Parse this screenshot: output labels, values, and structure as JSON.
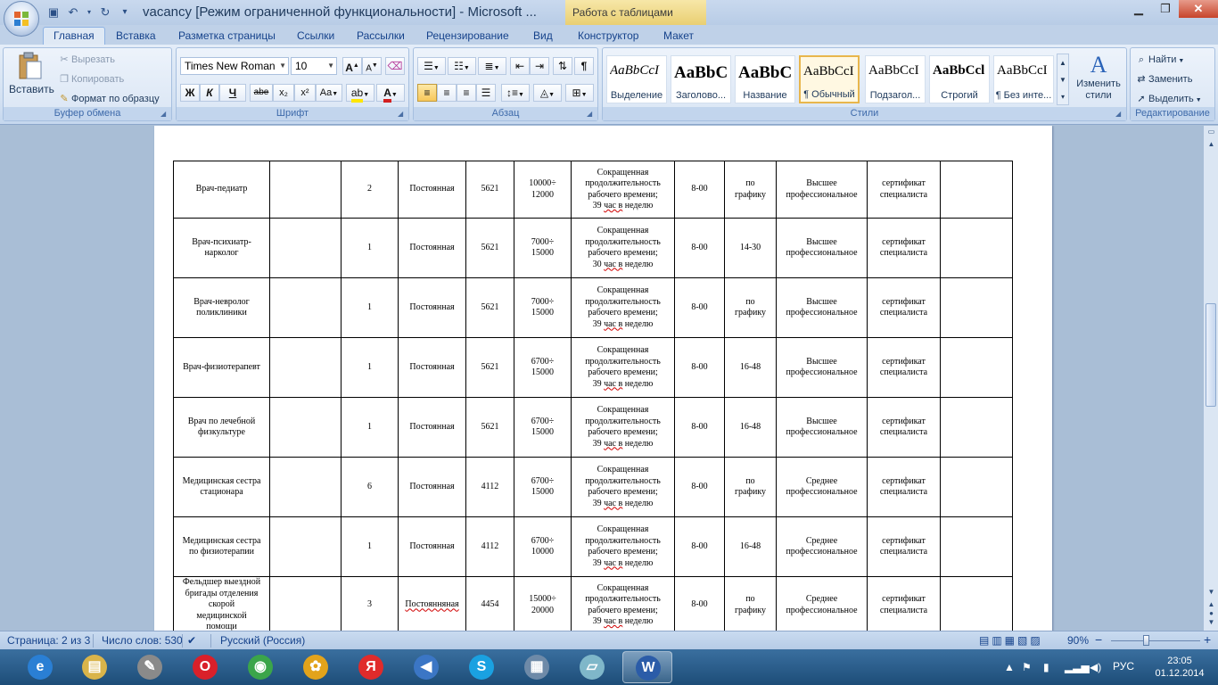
{
  "window": {
    "title": "vacancy [Режим ограниченной функциональности] - Microsoft ...",
    "context_tab_title": "Работа с таблицами"
  },
  "qat": {
    "save_icon": "save-icon",
    "undo_icon": "undo-icon",
    "redo_icon": "redo-icon"
  },
  "tabs": [
    "Главная",
    "Вставка",
    "Разметка страницы",
    "Ссылки",
    "Рассылки",
    "Рецензирование",
    "Вид",
    "Конструктор",
    "Макет"
  ],
  "clipboard": {
    "paste": "Вставить",
    "cut": "Вырезать",
    "copy": "Копировать",
    "format_painter": "Формат по образцу",
    "label": "Буфер обмена"
  },
  "font": {
    "name": "Times New Roman",
    "size": "10",
    "label": "Шрифт",
    "bold": "Ж",
    "italic": "К",
    "underline": "Ч",
    "strike": "abe",
    "sub": "x₂",
    "sup": "x²",
    "case": "Aa",
    "grow": "A",
    "shrink": "A"
  },
  "paragraph": {
    "label": "Абзац",
    "show_marks": "¶"
  },
  "styles": {
    "label": "Стили",
    "items": [
      {
        "sample": "AaBbCcI",
        "name": "Выделение"
      },
      {
        "sample": "AaBbC",
        "name": "Заголово..."
      },
      {
        "sample": "AaBbC",
        "name": "Название"
      },
      {
        "sample": "AaBbCcI",
        "name": "¶ Обычный"
      },
      {
        "sample": "AaBbCcI",
        "name": "Подзагол..."
      },
      {
        "sample": "AaBbCcl",
        "name": "Строгий"
      },
      {
        "sample": "AaBbCcI",
        "name": "¶ Без инте..."
      }
    ],
    "change_styles": "Изменить стили"
  },
  "editing": {
    "label": "Редактирование",
    "find": "Найти",
    "replace": "Заменить",
    "select": "Выделить"
  },
  "table_rows": [
    {
      "position": [
        "Врач-педиатр"
      ],
      "col2": "",
      "count": "2",
      "type": "Постоянная",
      "code": "5621",
      "salary": [
        "10000÷",
        "12000"
      ],
      "mode": [
        "Сокращенная",
        "продолжительность",
        "рабочего времени;",
        "39 час в неделю"
      ],
      "start": "8-00",
      "schedule": [
        "по",
        "графику"
      ],
      "education": [
        "Высшее",
        "профессиональное"
      ],
      "cert": [
        "сертификат",
        "специалиста"
      ],
      "last": ""
    },
    {
      "position": [
        "Врач-психиатр-",
        "нарколог"
      ],
      "col2": "",
      "count": "1",
      "type": "Постоянная",
      "code": "5621",
      "salary": [
        "7000÷",
        "15000"
      ],
      "mode": [
        "Сокращенная",
        "продолжительность",
        "рабочего времени;",
        "30 час в неделю"
      ],
      "start": "8-00",
      "schedule": [
        "14-30"
      ],
      "education": [
        "Высшее",
        "профессиональное"
      ],
      "cert": [
        "сертификат",
        "специалиста"
      ],
      "last": ""
    },
    {
      "position": [
        "Врач-невролог",
        "поликлиники"
      ],
      "col2": "",
      "count": "1",
      "type": "Постоянная",
      "code": "5621",
      "salary": [
        "7000÷",
        "15000"
      ],
      "mode": [
        "Сокращенная",
        "продолжительность",
        "рабочего времени;",
        "39 час в неделю"
      ],
      "start": "8-00",
      "schedule": [
        "по",
        "графику"
      ],
      "education": [
        "Высшее",
        "профессиональное"
      ],
      "cert": [
        "сертификат",
        "специалиста"
      ],
      "last": ""
    },
    {
      "position": [
        "Врач-физиотерапевт"
      ],
      "col2": "",
      "count": "1",
      "type": "Постоянная",
      "code": "5621",
      "salary": [
        "6700÷",
        "15000"
      ],
      "mode": [
        "Сокращенная",
        "продолжительность",
        "рабочего времени;",
        "39 час в неделю"
      ],
      "start": "8-00",
      "schedule": [
        "16-48"
      ],
      "education": [
        "Высшее",
        "профессиональное"
      ],
      "cert": [
        "сертификат",
        "специалиста"
      ],
      "last": ""
    },
    {
      "position": [
        "Врач по лечебной",
        "физкультуре"
      ],
      "col2": "",
      "count": "1",
      "type": "Постоянная",
      "code": "5621",
      "salary": [
        "6700÷",
        "15000"
      ],
      "mode": [
        "Сокращенная",
        "продолжительность",
        "рабочего времени;",
        "39 час в неделю"
      ],
      "start": "8-00",
      "schedule": [
        "16-48"
      ],
      "education": [
        "Высшее",
        "профессиональное"
      ],
      "cert": [
        "сертификат",
        "специалиста"
      ],
      "last": ""
    },
    {
      "position": [
        "Медицинская сестра",
        "стационара"
      ],
      "col2": "",
      "count": "6",
      "type": "Постоянная",
      "code": "4112",
      "salary": [
        "6700÷",
        "15000"
      ],
      "mode": [
        "Сокращенная",
        "продолжительность",
        "рабочего времени;",
        "39 час в неделю"
      ],
      "start": "8-00",
      "schedule": [
        "по",
        "графику"
      ],
      "education": [
        "Среднее",
        "профессиональное"
      ],
      "cert": [
        "сертификат",
        "специалиста"
      ],
      "last": ""
    },
    {
      "position": [
        "Медицинская сестра",
        "по физиотерапии"
      ],
      "col2": "",
      "count": "1",
      "type": "Постоянная",
      "code": "4112",
      "salary": [
        "6700÷",
        "10000"
      ],
      "mode": [
        "Сокращенная",
        "продолжительность",
        "рабочего времени;",
        "39 час в неделю"
      ],
      "start": "8-00",
      "schedule": [
        "16-48"
      ],
      "education": [
        "Среднее",
        "профессиональное"
      ],
      "cert": [
        "сертификат",
        "специалиста"
      ],
      "last": ""
    },
    {
      "position": [
        "Фельдшер выездной",
        "бригады отделения",
        "скорой",
        "медицинской",
        "помощи"
      ],
      "col2": "",
      "count": "3",
      "type": "Постоянняная",
      "code": "4454",
      "salary": [
        "15000÷",
        "20000"
      ],
      "mode": [
        "Сокращенная",
        "продолжительность",
        "рабочего времени;",
        "39 час в неделю"
      ],
      "start": "8-00",
      "schedule": [
        "по",
        "графику"
      ],
      "education": [
        "Среднее",
        "профессиональное"
      ],
      "cert": [
        "сертификат",
        "специалиста"
      ],
      "last": ""
    }
  ],
  "status": {
    "page": "Страница: 2 из 3",
    "words": "Число слов: 530",
    "language": "Русский (Россия)",
    "zoom": "90%",
    "zoom_minus": "−",
    "zoom_plus": "+",
    "zoom_level": 0.4
  },
  "taskbar": {
    "apps": [
      {
        "name": "ie-icon",
        "glyph": "e",
        "color": "#2a7fd4"
      },
      {
        "name": "explorer-icon",
        "glyph": "▤",
        "color": "#d9b44a"
      },
      {
        "name": "utility-icon",
        "glyph": "✎",
        "color": "#8a8a8a"
      },
      {
        "name": "opera-icon",
        "glyph": "O",
        "color": "#d9202a"
      },
      {
        "name": "chrome-icon",
        "glyph": "◉",
        "color": "#3ba54a"
      },
      {
        "name": "picasa-icon",
        "glyph": "✿",
        "color": "#e2a31b"
      },
      {
        "name": "yandex-icon",
        "glyph": "Я",
        "color": "#e02b2b"
      },
      {
        "name": "audio-icon",
        "glyph": "◀",
        "color": "#3b76c5"
      },
      {
        "name": "skype-icon",
        "glyph": "S",
        "color": "#1aa1e1"
      },
      {
        "name": "calculator-icon",
        "glyph": "▦",
        "color": "#6e8aa8"
      },
      {
        "name": "notes-icon",
        "glyph": "▱",
        "color": "#7fb7c9"
      },
      {
        "name": "word-icon",
        "glyph": "W",
        "color": "#2b5ca8"
      }
    ],
    "lang": "РУС",
    "time": "23:05",
    "date": "01.12.2014"
  }
}
